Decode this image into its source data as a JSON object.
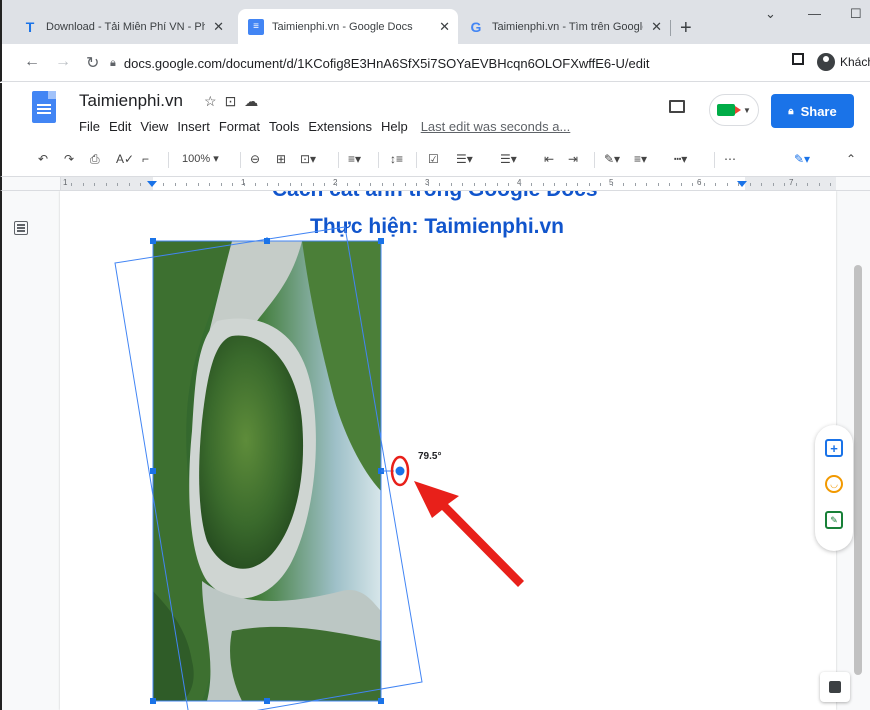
{
  "tabs": [
    {
      "favicon": "T",
      "title": "Download - Tải Miễn Phí VN - Ph",
      "close": "✕"
    },
    {
      "favicon": "≡",
      "title": "Taimienphi.vn - Google Docs",
      "close": "✕"
    },
    {
      "favicon": "G",
      "title": "Taimienphi.vn - Tìm trên Google",
      "close": "✕"
    }
  ],
  "new_tab": "+",
  "window_controls": {
    "menu": "⌄",
    "minimize": "—",
    "maximize": "☐"
  },
  "address_bar": {
    "url": "docs.google.com/document/d/1KCofig8E3HnA6SfX5i7SOYaEVBHcqn6OLOFXwffE6-U/edit",
    "profile_label": "Khách"
  },
  "doc": {
    "title": "Taimienphi.vn",
    "menu": [
      "File",
      "Edit",
      "View",
      "Insert",
      "Format",
      "Tools",
      "Extensions",
      "Help"
    ],
    "last_edit": "Last edit was seconds a...",
    "share_label": "Share",
    "heading1": "Cách cắt ảnh trong Google Docs",
    "heading2": "Thực hiện: Taimienphi.vn",
    "rotation_angle": "79.5°"
  },
  "format_toolbar": {
    "zoom": "100%"
  },
  "ruler_labels": [
    "1",
    "1",
    "2",
    "3",
    "4",
    "5",
    "6",
    "7"
  ],
  "colors": {
    "accent": "#1a73e8",
    "selection": "#4285f4",
    "heading": "#1155cc",
    "arrow": "#e8201a"
  },
  "icons": [
    "undo-icon",
    "redo-icon",
    "print-icon",
    "spellcheck-icon",
    "paint-format-icon",
    "link-icon",
    "comment-add-icon",
    "image-icon",
    "align-icon",
    "line-spacing-icon",
    "checklist-icon",
    "bullet-list-icon",
    "numbered-list-icon",
    "indent-decrease-icon",
    "indent-increase-icon",
    "pen-icon",
    "highlight-icon",
    "more-icon",
    "edit-mode-icon",
    "collapse-icon"
  ]
}
